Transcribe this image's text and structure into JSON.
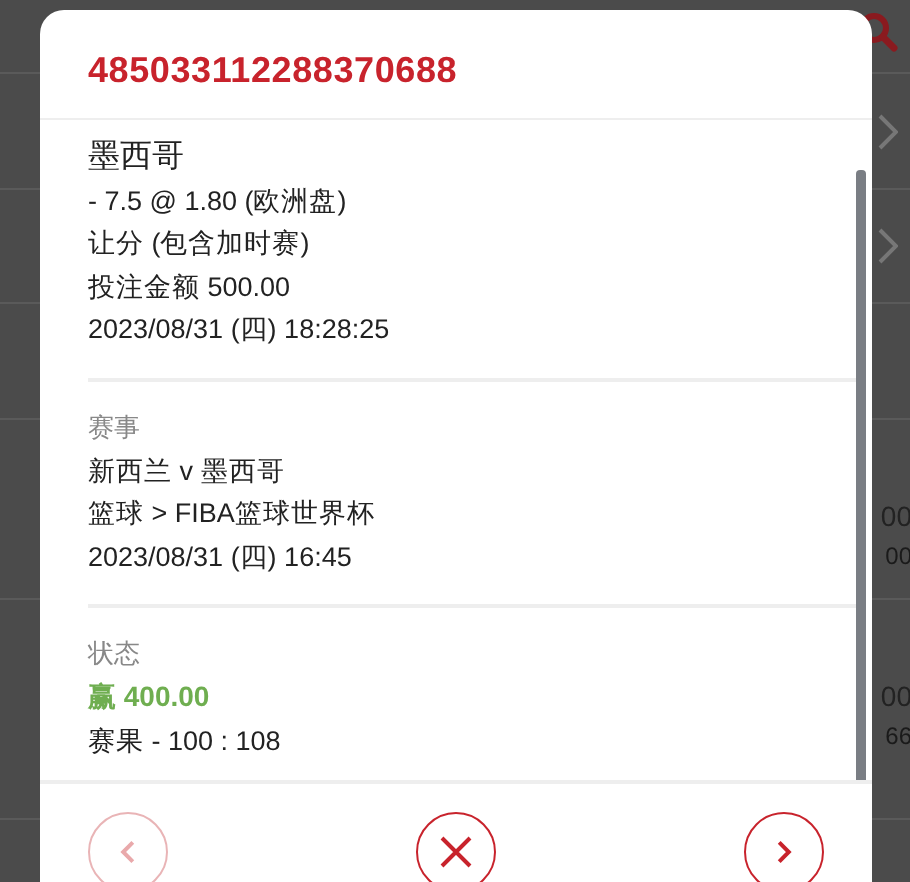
{
  "background": {
    "rows": [
      {
        "chevron": false,
        "values": []
      },
      {
        "chevron": true,
        "values": []
      },
      {
        "chevron": true,
        "values": []
      },
      {
        "chevron": false,
        "values": []
      },
      {
        "chevron": false,
        "values": [
          "00",
          "00"
        ]
      },
      {
        "chevron": false,
        "values": [
          "00",
          "66"
        ]
      }
    ]
  },
  "modal": {
    "title": "485033112288370688",
    "sections": [
      {
        "lines": [
          {
            "kind": "title",
            "text": "墨西哥"
          },
          {
            "kind": "normal",
            "text": "- 7.5 @ 1.80 (欧洲盘)"
          },
          {
            "kind": "normal",
            "text": "让分 (包含加时赛)"
          },
          {
            "kind": "normal",
            "text": "投注金额 500.00"
          },
          {
            "kind": "normal",
            "text": "2023/08/31 (四) 18:28:25"
          }
        ]
      },
      {
        "label": "赛事",
        "lines": [
          {
            "kind": "normal",
            "text": "新西兰 v 墨西哥"
          },
          {
            "kind": "normal",
            "text": "篮球 > FIBA篮球世界杯"
          },
          {
            "kind": "normal",
            "text": "2023/08/31 (四) 16:45"
          }
        ]
      },
      {
        "label": "状态",
        "lines": [
          {
            "kind": "win",
            "text": "赢 400.00"
          },
          {
            "kind": "normal",
            "text": "赛果 - 100 : 108"
          }
        ]
      }
    ],
    "footer": [
      {
        "kind": "prev",
        "disabled": true
      },
      {
        "kind": "close",
        "disabled": false
      },
      {
        "kind": "next",
        "disabled": false
      }
    ]
  }
}
